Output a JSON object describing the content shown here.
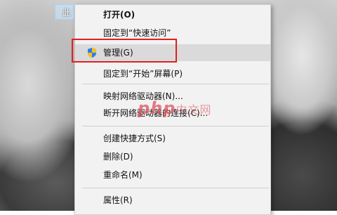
{
  "desktop": {
    "icon_label": "此"
  },
  "context_menu": {
    "items": [
      {
        "label": "打开(O)"
      },
      {
        "label": "固定到“快速访问”"
      },
      {
        "label": "管理(G)",
        "icon": "uac-shield-icon"
      },
      {
        "label": "固定到“开始”屏幕(P)"
      },
      {
        "label": "映射网络驱动器(N)..."
      },
      {
        "label": "断开网络驱动器的连接(C)..."
      },
      {
        "label": "创建快捷方式(S)"
      },
      {
        "label": "删除(D)"
      },
      {
        "label": "重命名(M)"
      },
      {
        "label": "属性(R)"
      }
    ]
  },
  "highlight_color": "#e02020",
  "watermark": {
    "brand": "php",
    "suffix": "中文网"
  }
}
